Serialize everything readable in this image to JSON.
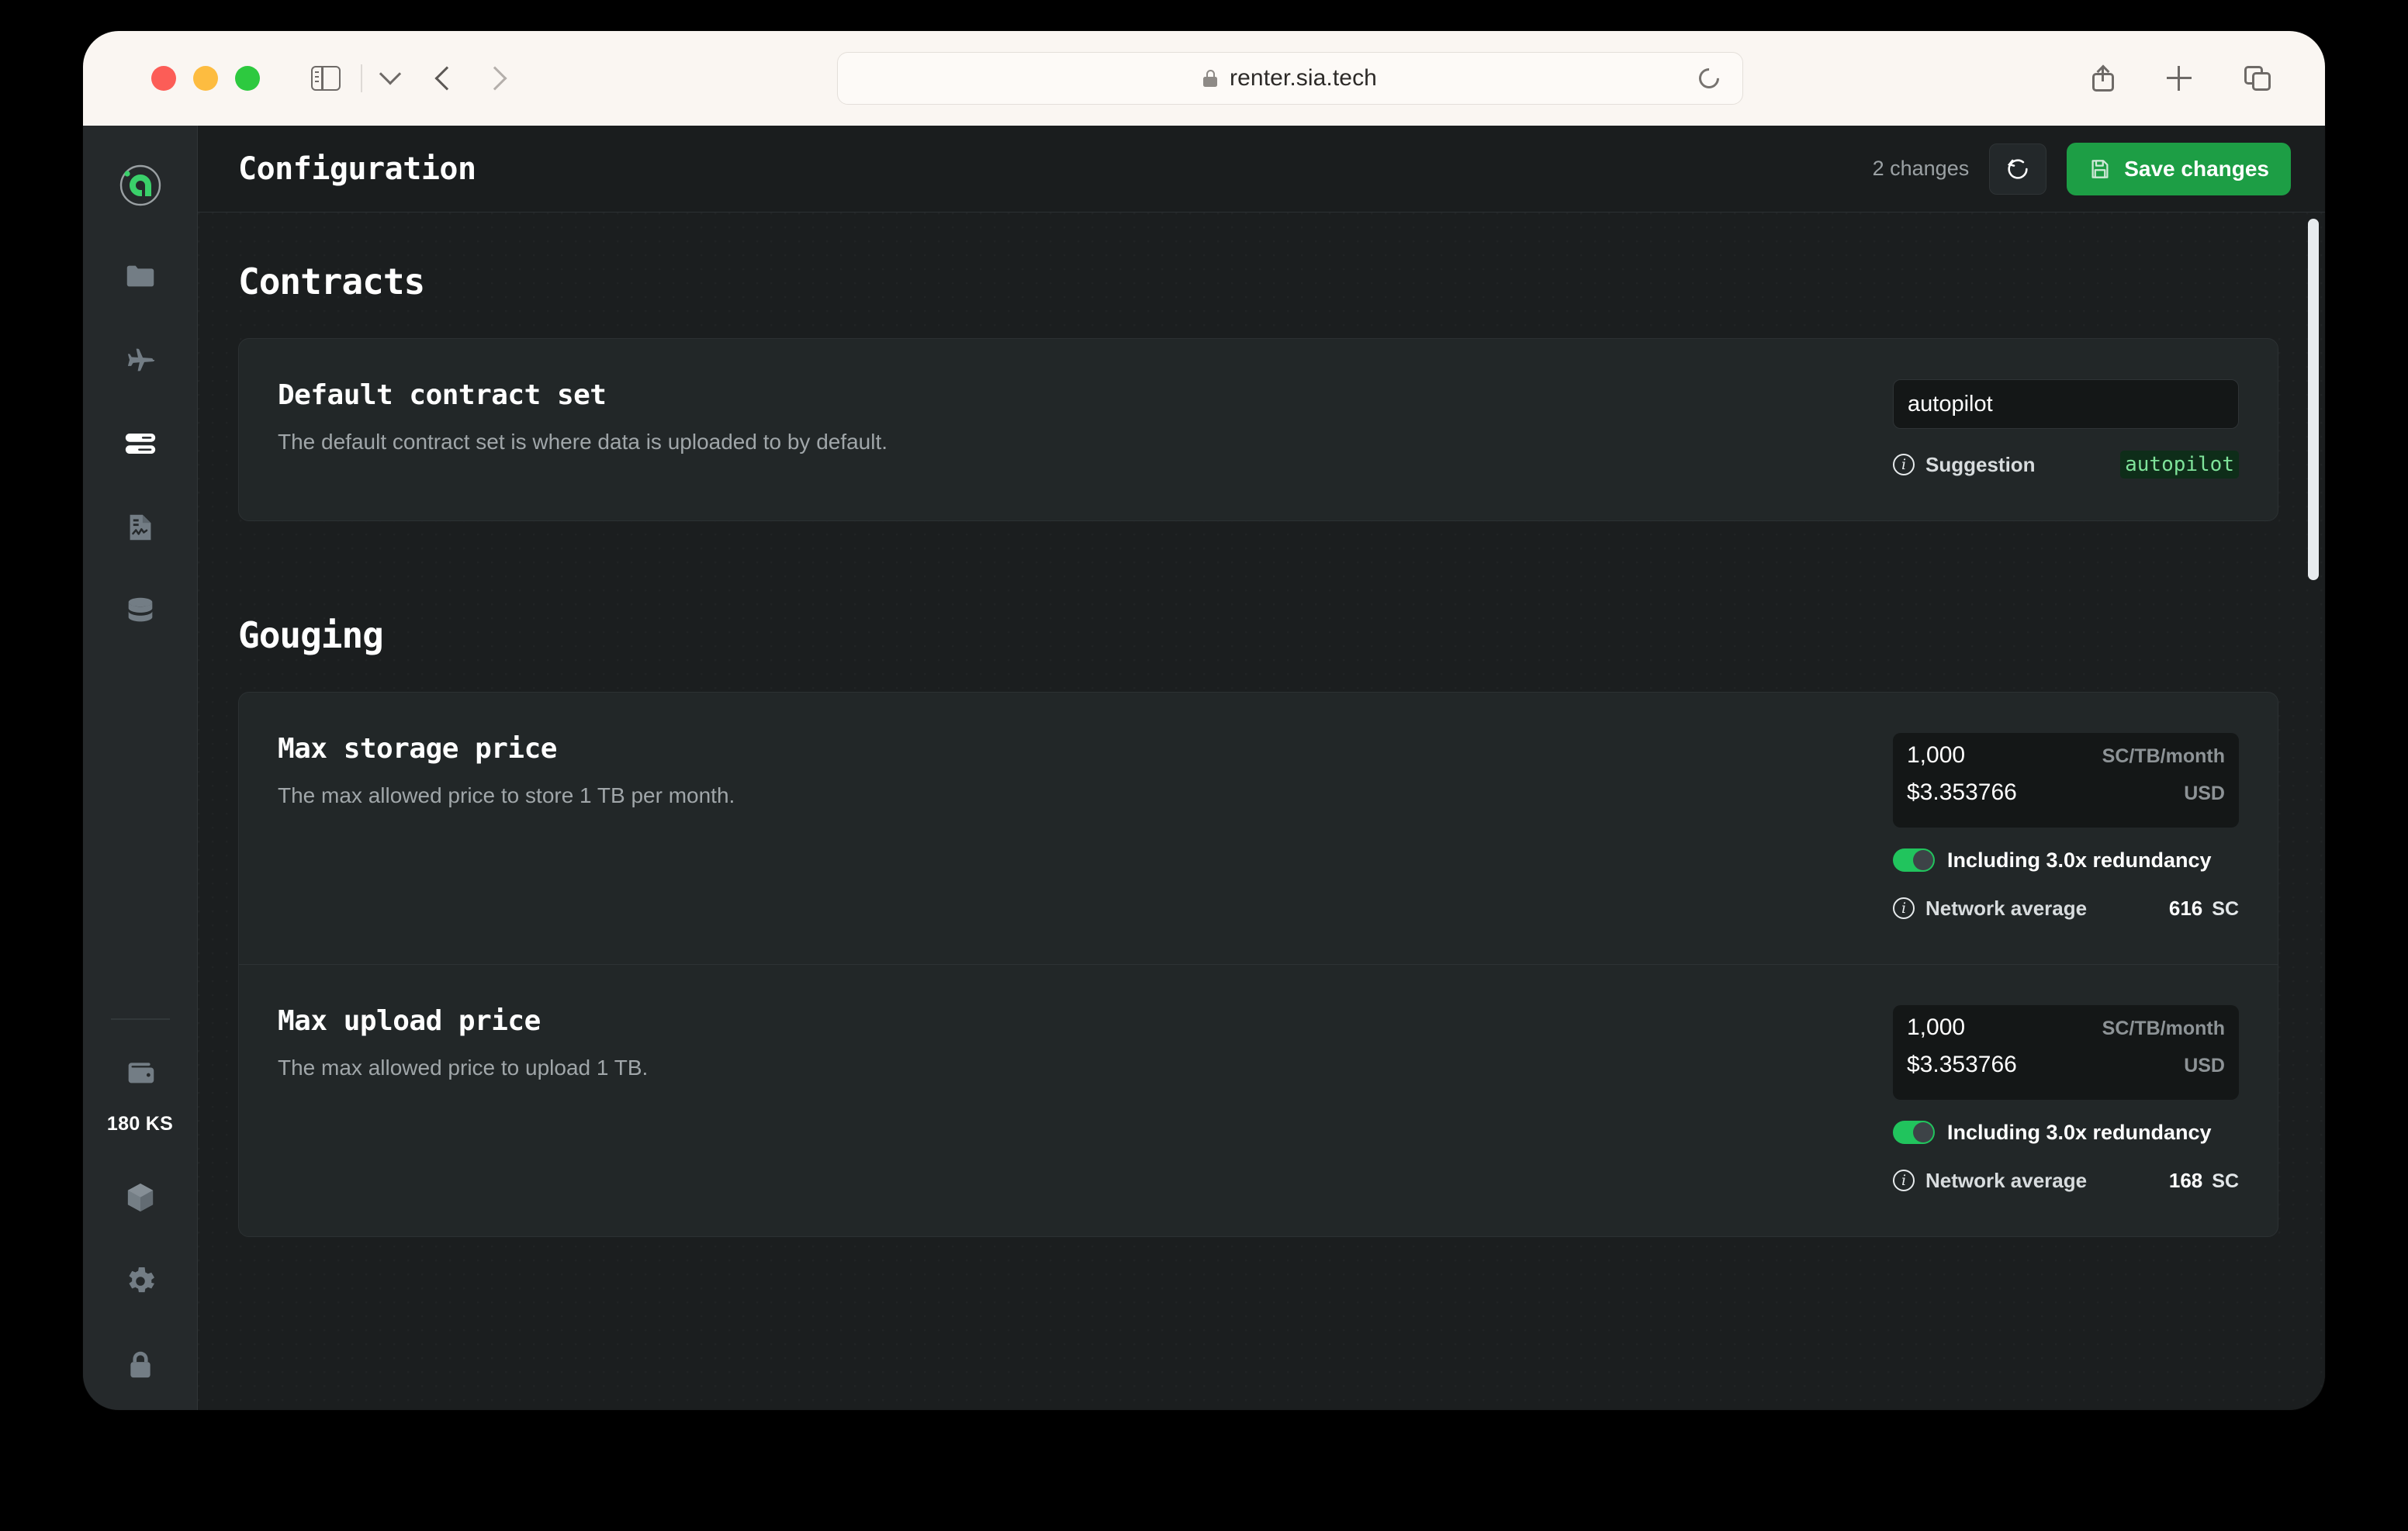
{
  "browser": {
    "url": "renter.sia.tech",
    "lock_icon": "lock-icon",
    "reload_icon": "reload-icon",
    "sidebar_toggle_icon": "sidebar-toggle-icon",
    "back_icon": "chevron-left-icon",
    "forward_icon": "chevron-right-icon",
    "share_icon": "share-icon",
    "new_tab_icon": "plus-icon",
    "tabs_icon": "tab-overview-icon"
  },
  "sidebar": {
    "logo": "sia-logo-icon",
    "items": [
      {
        "name": "files",
        "icon": "folder-icon",
        "active": false
      },
      {
        "name": "autopilot",
        "icon": "airplane-icon",
        "active": false
      },
      {
        "name": "hosts",
        "icon": "server-icon",
        "active": true
      },
      {
        "name": "contracts",
        "icon": "document-chart-icon",
        "active": false
      },
      {
        "name": "volumes",
        "icon": "database-icon",
        "active": false
      }
    ],
    "wallet": {
      "icon": "wallet-icon",
      "balance": "180 KS"
    },
    "bottom_items": [
      {
        "name": "node",
        "icon": "cube-icon"
      },
      {
        "name": "settings",
        "icon": "gear-icon"
      },
      {
        "name": "lock",
        "icon": "padlock-icon"
      }
    ]
  },
  "header": {
    "title": "Configuration",
    "changes_label": "2 changes",
    "revert_icon": "revert-arrow-icon",
    "save_icon": "floppy-disk-icon",
    "save_label": "Save changes"
  },
  "sections": [
    {
      "title": "Contracts",
      "rows": [
        {
          "title": "Default contract set",
          "description": "The default contract set is where data is uploaded to by default.",
          "control": "text",
          "value": "autopilot",
          "suggestion_label": "Suggestion",
          "suggestion_value": "autopilot"
        }
      ]
    },
    {
      "title": "Gouging",
      "rows": [
        {
          "title": "Max storage price",
          "description": "The max allowed price to store 1 TB per month.",
          "control": "price",
          "primary_value": "1,000",
          "primary_unit": "SC/TB/month",
          "secondary_value": "$3.353766",
          "secondary_unit": "USD",
          "toggle_on": true,
          "toggle_label": "Including 3.0x redundancy",
          "average_label": "Network average",
          "average_value": "616",
          "average_unit": "SC"
        },
        {
          "title": "Max upload price",
          "description": "The max allowed price to upload 1 TB.",
          "control": "price",
          "primary_value": "1,000",
          "primary_unit": "SC/TB/month",
          "secondary_value": "$3.353766",
          "secondary_unit": "USD",
          "toggle_on": true,
          "toggle_label": "Including 3.0x redundancy",
          "average_label": "Network average",
          "average_value": "168",
          "average_unit": "SC"
        }
      ]
    }
  ],
  "colors": {
    "accent_green": "#1d9e45",
    "toggle_green": "#21c45d",
    "logo_green": "#3ad06a",
    "suggestion_text": "#7fe39a",
    "suggestion_bg": "#0e2d19"
  }
}
